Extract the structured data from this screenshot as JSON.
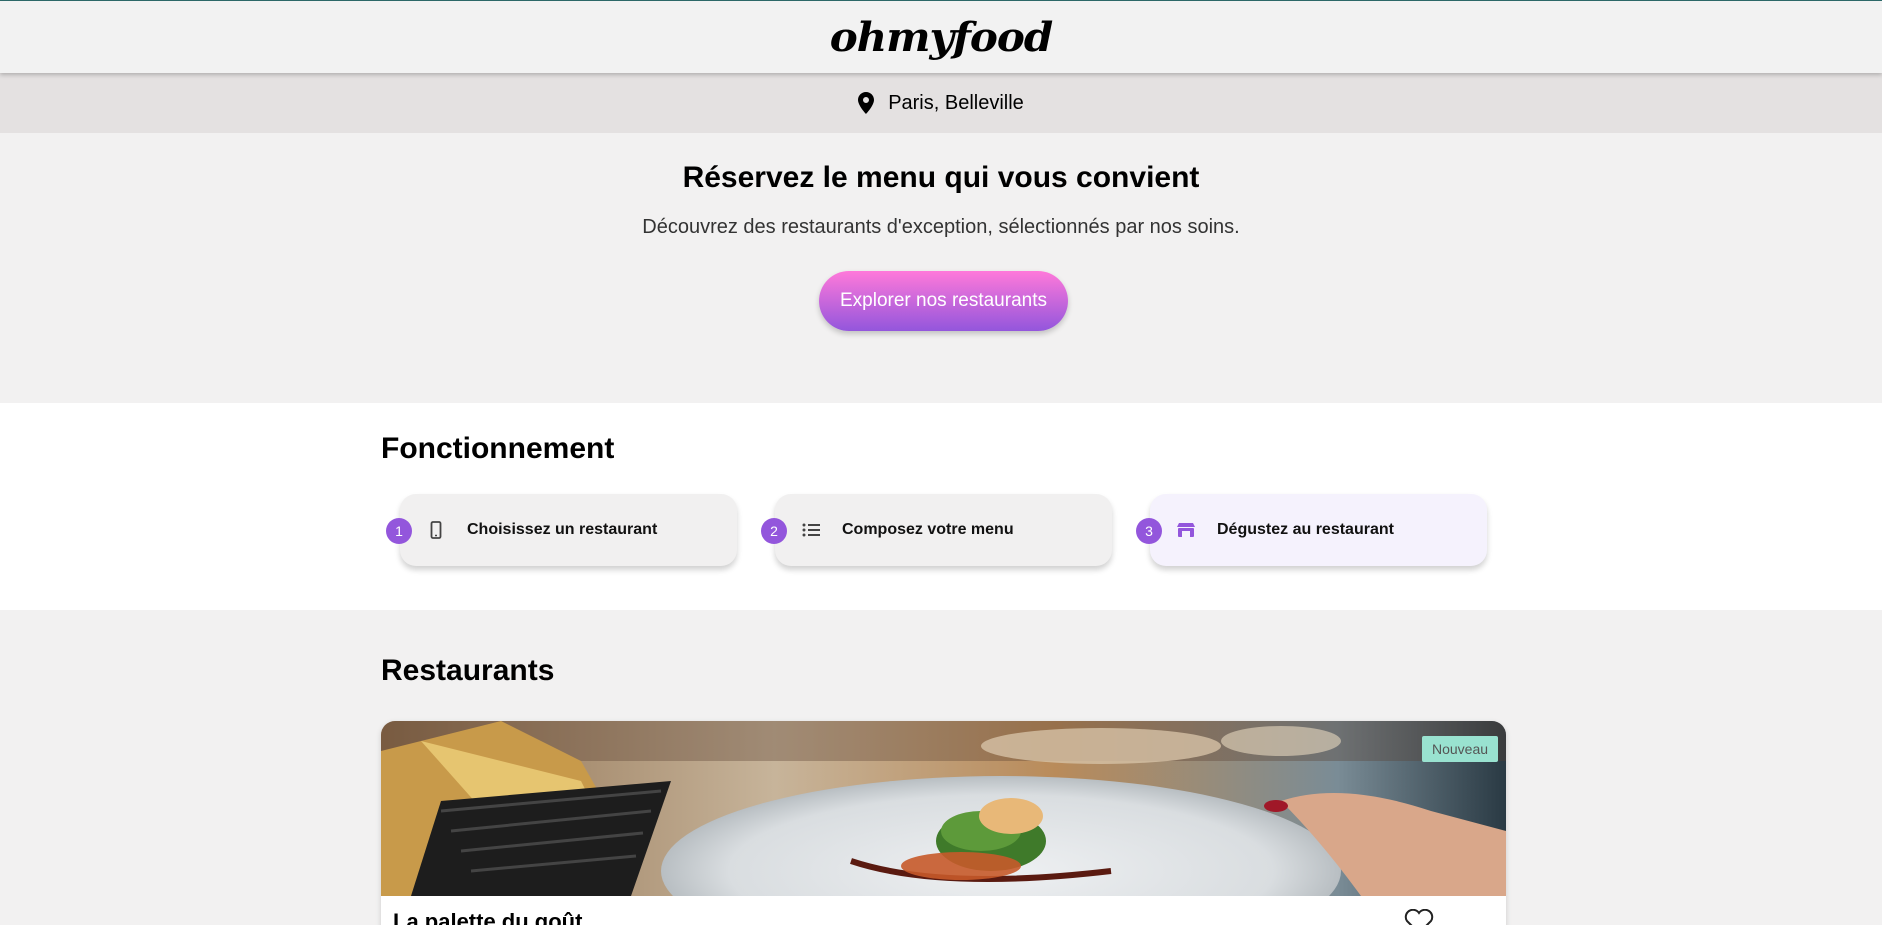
{
  "header": {
    "logo": "ohmyfood"
  },
  "location": {
    "icon": "map-pin-icon",
    "text": "Paris, Belleville"
  },
  "hero": {
    "title": "Réservez le menu qui vous convient",
    "subtitle": "Découvrez des restaurants d'exception, sélectionnés par nos soins.",
    "cta_label": "Explorer nos restaurants"
  },
  "how": {
    "title": "Fonctionnement",
    "steps": [
      {
        "number": "1",
        "icon": "mobile-phone-icon",
        "label": "Choisissez un restaurant"
      },
      {
        "number": "2",
        "icon": "list-icon",
        "label": "Composez votre menu"
      },
      {
        "number": "3",
        "icon": "store-icon",
        "label": "Dégustez au restaurant"
      }
    ]
  },
  "restaurants": {
    "title": "Restaurants",
    "cards": [
      {
        "badge": "Nouveau",
        "title": "La palette du goût",
        "image": "plated-fish-dish-photo",
        "favorite_icon": "heart-outline-icon"
      }
    ]
  },
  "colors": {
    "accent_purple": "#9356dc",
    "accent_pink": "#ff79da",
    "badge_green": "#99e2d0"
  }
}
